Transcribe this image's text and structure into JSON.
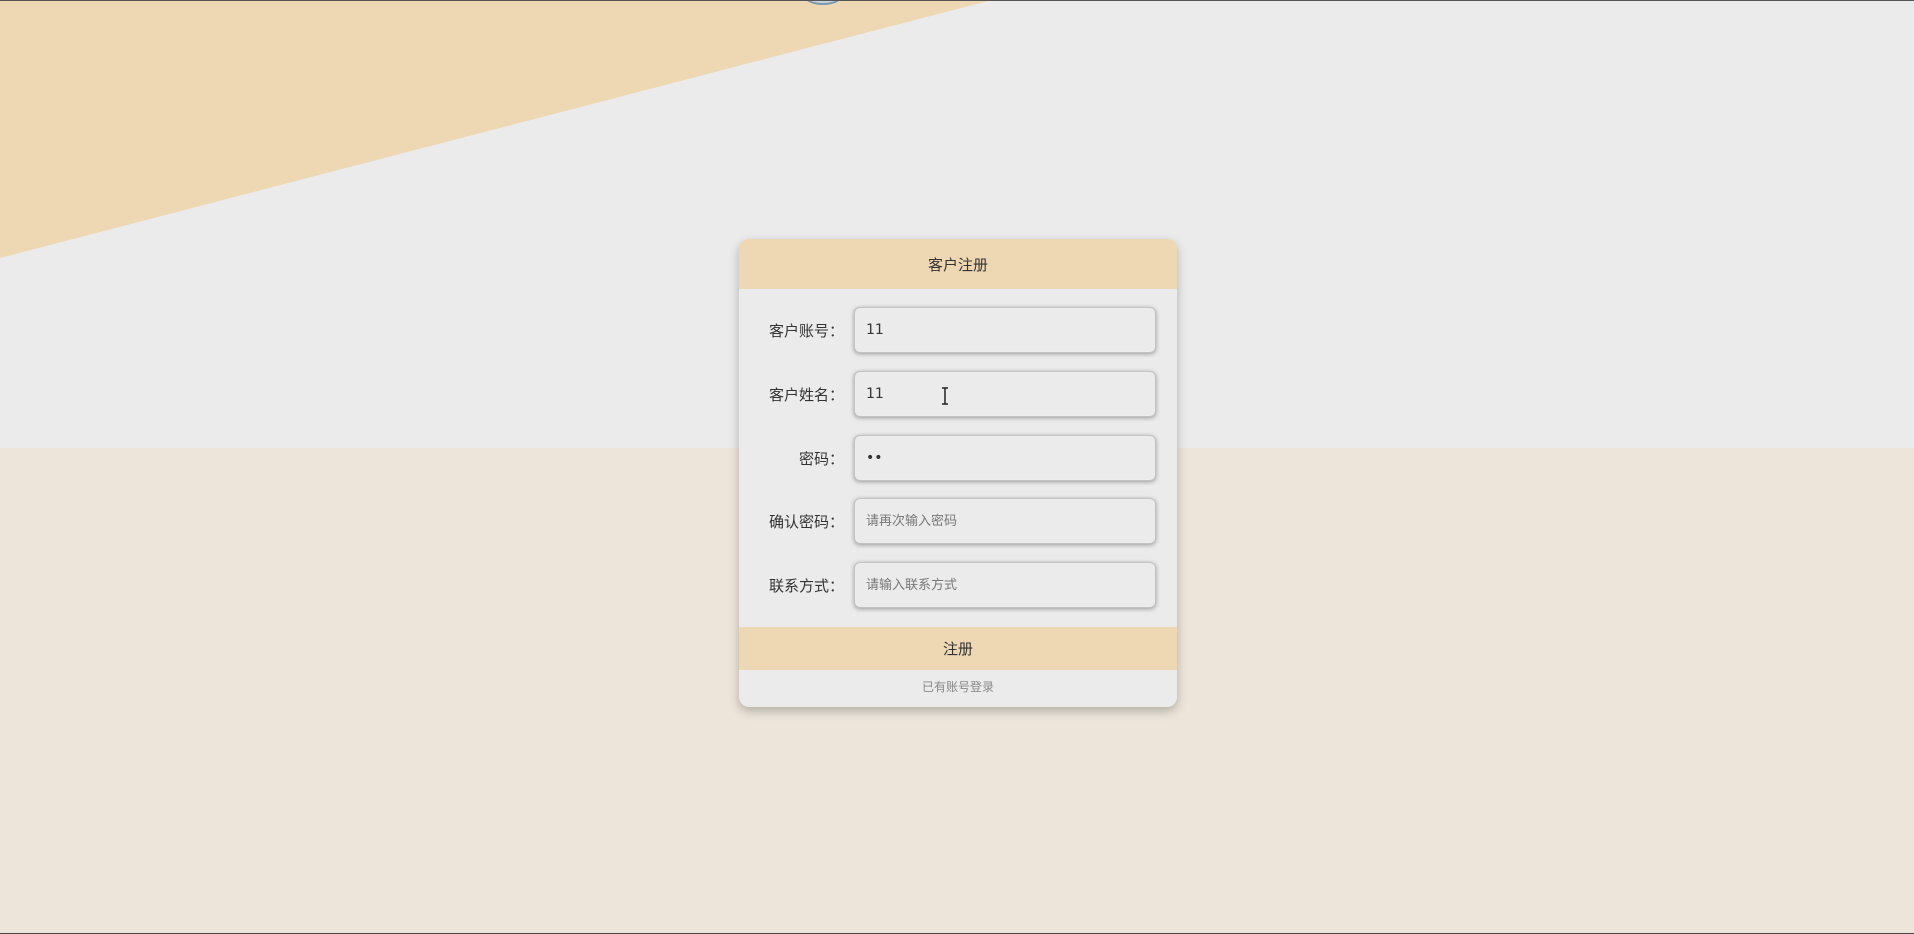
{
  "register_form": {
    "title": "客户注册",
    "fields": [
      {
        "label": "客户账号：",
        "value": "11",
        "placeholder": "",
        "type": "text"
      },
      {
        "label": "客户姓名：",
        "value": "11",
        "placeholder": "",
        "type": "text"
      },
      {
        "label": "密码：",
        "value": "11",
        "placeholder": "",
        "type": "password"
      },
      {
        "label": "确认密码：",
        "value": "",
        "placeholder": "请再次输入密码",
        "type": "password"
      },
      {
        "label": "联系方式：",
        "value": "",
        "placeholder": "请输入联系方式",
        "type": "text"
      }
    ],
    "submit_label": "注册",
    "login_link_label": "已有账号登录"
  },
  "colors": {
    "accent": "#eed7b3",
    "background": "#ebebeb",
    "bottom_band": "#ede5da",
    "diagonal": "#eed7b3"
  },
  "icons": {
    "cursor": "text-cursor-icon"
  }
}
